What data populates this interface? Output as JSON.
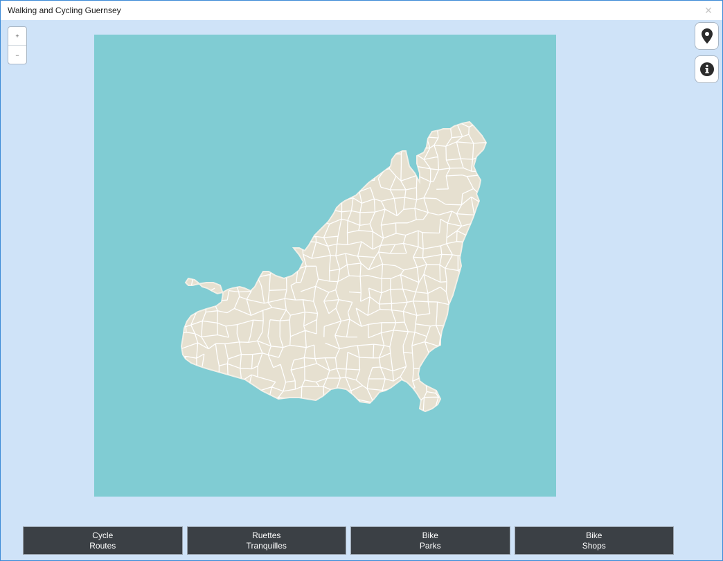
{
  "window": {
    "title": "Walking and Cycling Guernsey",
    "close_glyph": "✕"
  },
  "zoom": {
    "in_glyph": "+",
    "out_glyph": "−"
  },
  "map": {
    "sea_color": "#80ccd3",
    "land_color": "#e6e0d0",
    "road_color": "#ffffff"
  },
  "side_buttons": [
    {
      "icon": "map-pin-icon"
    },
    {
      "icon": "info-icon"
    }
  ],
  "nav_buttons": [
    {
      "line1": "Cycle",
      "line2": "Routes"
    },
    {
      "line1": "Ruettes",
      "line2": "Tranquilles"
    },
    {
      "line1": "Bike",
      "line2": "Parks"
    },
    {
      "line1": "Bike",
      "line2": "Shops"
    }
  ]
}
